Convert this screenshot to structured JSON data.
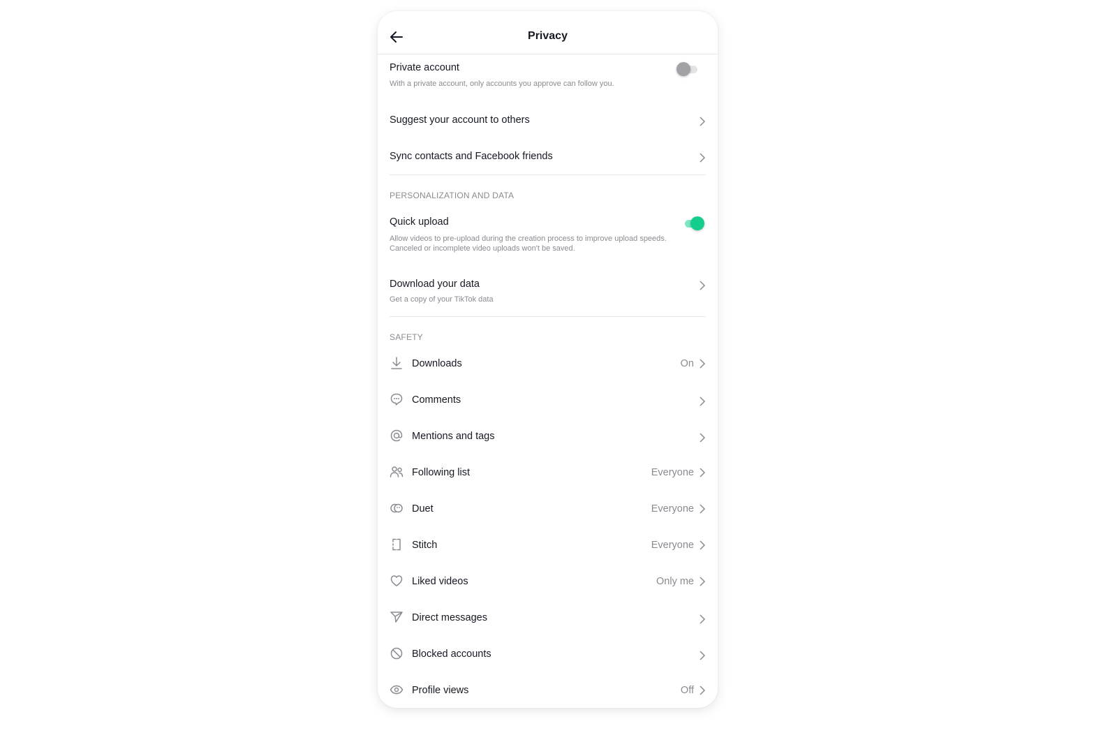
{
  "header": {
    "title": "Privacy",
    "back_icon": "arrow-left-icon"
  },
  "account": {
    "private_account": {
      "label": "Private account",
      "description": "With a private account, only accounts you approve can follow you.",
      "enabled": false
    },
    "suggest": {
      "label": "Suggest your account to others"
    },
    "sync": {
      "label": "Sync contacts and Facebook friends"
    }
  },
  "personalization": {
    "title": "PERSONALIZATION AND DATA",
    "quick_upload": {
      "label": "Quick upload",
      "description_1": "Allow videos to pre-upload during the creation process to improve upload speeds.",
      "description_2": "Canceled or incomplete video uploads won't be saved.",
      "enabled": true
    },
    "download_data": {
      "label": "Download your data",
      "description": "Get a copy of your TikTok data"
    }
  },
  "safety": {
    "title": "SAFETY",
    "items": [
      {
        "label": "Downloads",
        "value": "On",
        "icon": "download-icon"
      },
      {
        "label": "Comments",
        "value": "",
        "icon": "comment-icon"
      },
      {
        "label": "Mentions and tags",
        "value": "",
        "icon": "at-sign-icon"
      },
      {
        "label": "Following list",
        "value": "Everyone",
        "icon": "people-icon"
      },
      {
        "label": "Duet",
        "value": "Everyone",
        "icon": "duet-icon"
      },
      {
        "label": "Stitch",
        "value": "Everyone",
        "icon": "stitch-icon"
      },
      {
        "label": "Liked videos",
        "value": "Only me",
        "icon": "heart-icon"
      },
      {
        "label": "Direct messages",
        "value": "",
        "icon": "send-icon"
      },
      {
        "label": "Blocked accounts",
        "value": "",
        "icon": "block-icon"
      },
      {
        "label": "Profile views",
        "value": "Off",
        "icon": "eye-icon"
      }
    ]
  },
  "colors": {
    "accent_green": "#14cf8b",
    "text_primary": "#161823",
    "text_secondary": "#8a8b91"
  }
}
